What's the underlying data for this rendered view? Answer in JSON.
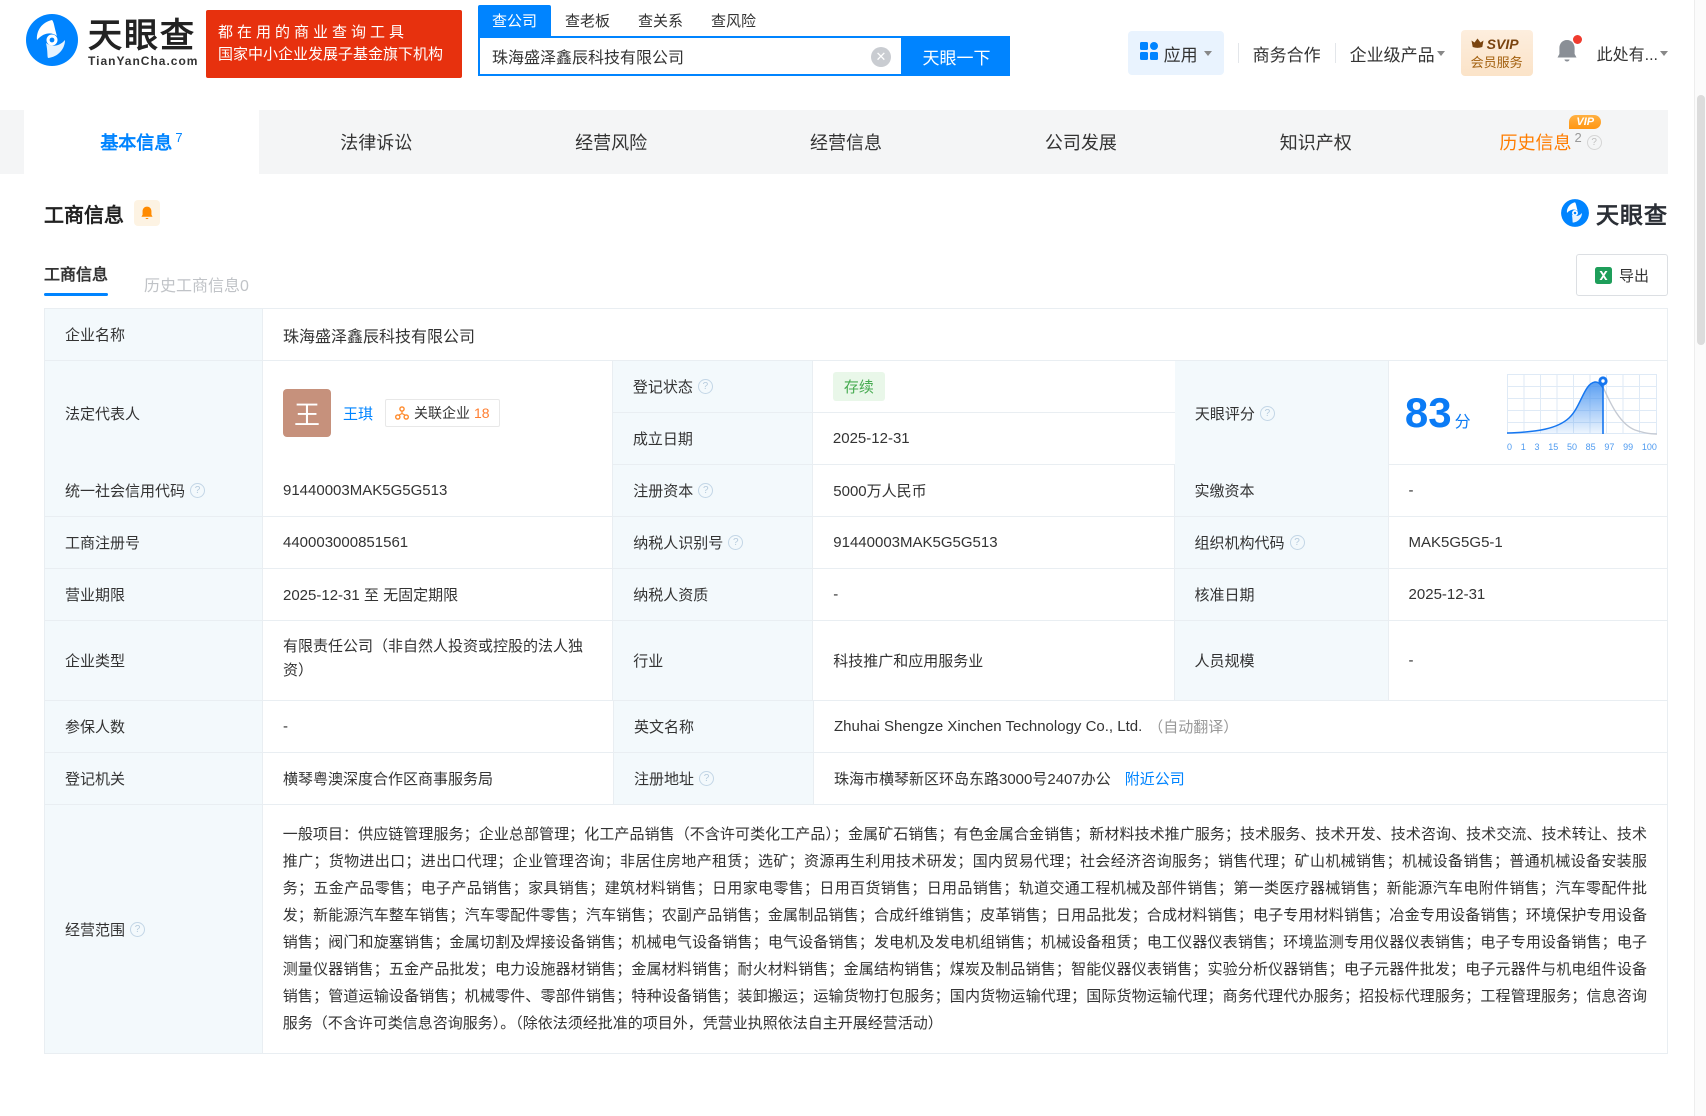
{
  "header": {
    "brand": {
      "title": "天眼查",
      "domain": "TianYanCha.com"
    },
    "promo": {
      "line1": "都在用的商业查询工具",
      "line2": "国家中小企业发展子基金旗下机构"
    },
    "search": {
      "tabs": [
        {
          "label": "查公司"
        },
        {
          "label": "查老板"
        },
        {
          "label": "查关系"
        },
        {
          "label": "查风险"
        }
      ],
      "value": "珠海盛泽鑫辰科技有限公司",
      "button": "天眼一下"
    },
    "menu": {
      "apps": "应用",
      "cooperation": "商务合作",
      "enterprise": "企业级产品",
      "svip_top": "SVIP",
      "svip_bottom": "会员服务",
      "user": "此处有..."
    }
  },
  "nav": {
    "tabs": [
      {
        "label": "基本信息",
        "badge": "7"
      },
      {
        "label": "法律诉讼",
        "badge": ""
      },
      {
        "label": "经营风险",
        "badge": ""
      },
      {
        "label": "经营信息",
        "badge": ""
      },
      {
        "label": "公司发展",
        "badge": ""
      },
      {
        "label": "知识产权",
        "badge": ""
      },
      {
        "label": "历史信息",
        "badge": "2",
        "vip": "VIP"
      }
    ]
  },
  "section": {
    "title": "工商信息",
    "watermark": "天眼查",
    "subtab_active": "工商信息",
    "subtab_history": "历史工商信息0",
    "export_label": "导出"
  },
  "table": {
    "company_name": {
      "label": "企业名称",
      "value": "珠海盛泽鑫辰科技有限公司"
    },
    "legal_rep": {
      "label": "法定代表人",
      "avatar": "王",
      "name": "王琪",
      "related_label": "关联企业",
      "related_count": "18"
    },
    "reg_status": {
      "label": "登记状态",
      "value": "存续"
    },
    "establish_date": {
      "label": "成立日期",
      "value": "2025-12-31"
    },
    "score": {
      "label": "天眼评分",
      "value": "83",
      "unit": "分",
      "ticks": [
        "0",
        "1",
        "3",
        "15",
        "50",
        "85",
        "97",
        "99",
        "100"
      ]
    },
    "credit_code": {
      "label": "统一社会信用代码",
      "value": "91440003MAK5G5G513"
    },
    "reg_capital": {
      "label": "注册资本",
      "value": "5000万人民币"
    },
    "paid_capital": {
      "label": "实缴资本",
      "value": "-"
    },
    "reg_number": {
      "label": "工商注册号",
      "value": "440003000851561"
    },
    "taxpayer_id": {
      "label": "纳税人识别号",
      "value": "91440003MAK5G5G513"
    },
    "org_code": {
      "label": "组织机构代码",
      "value": "MAK5G5G5-1"
    },
    "business_term": {
      "label": "营业期限",
      "value": "2025-12-31 至 无固定期限"
    },
    "taxpayer_qualification": {
      "label": "纳税人资质",
      "value": "-"
    },
    "approval_date": {
      "label": "核准日期",
      "value": "2025-12-31"
    },
    "company_type": {
      "label": "企业类型",
      "value": "有限责任公司（非自然人投资或控股的法人独资）"
    },
    "industry": {
      "label": "行业",
      "value": "科技推广和应用服务业"
    },
    "staff_size": {
      "label": "人员规模",
      "value": "-"
    },
    "insured_count": {
      "label": "参保人数",
      "value": "-"
    },
    "english_name": {
      "label": "英文名称",
      "value": "Zhuhai Shengze Xinchen Technology Co., Ltd.",
      "note": "（自动翻译）"
    },
    "reg_authority": {
      "label": "登记机关",
      "value": "横琴粤澳深度合作区商事服务局"
    },
    "reg_address": {
      "label": "注册地址",
      "value": "珠海市横琴新区环岛东路3000号2407办公",
      "link": "附近公司"
    },
    "business_scope": {
      "label": "经营范围",
      "value": "一般项目：供应链管理服务；企业总部管理；化工产品销售（不含许可类化工产品）；金属矿石销售；有色金属合金销售；新材料技术推广服务；技术服务、技术开发、技术咨询、技术交流、技术转让、技术推广；货物进出口；进出口代理；企业管理咨询；非居住房地产租赁；选矿；资源再生利用技术研发；国内贸易代理；社会经济咨询服务；销售代理；矿山机械销售；机械设备销售；普通机械设备安装服务；五金产品零售；电子产品销售；家具销售；建筑材料销售；日用家电零售；日用百货销售；日用品销售；轨道交通工程机械及部件销售；第一类医疗器械销售；新能源汽车电附件销售；汽车零配件批发；新能源汽车整车销售；汽车零配件零售；汽车销售；农副产品销售；金属制品销售；合成纤维销售；皮革销售；日用品批发；合成材料销售；电子专用材料销售；冶金专用设备销售；环境保护专用设备销售；阀门和旋塞销售；金属切割及焊接设备销售；机械电气设备销售；电气设备销售；发电机及发电机组销售；机械设备租赁；电工仪器仪表销售；环境监测专用仪器仪表销售；电子专用设备销售；电子测量仪器销售；五金产品批发；电力设施器材销售；金属材料销售；耐火材料销售；金属结构销售；煤炭及制品销售；智能仪器仪表销售；实验分析仪器销售；电子元器件批发；电子元器件与机电组件设备销售；管道运输设备销售；机械零件、零部件销售；特种设备销售；装卸搬运；运输货物打包服务；国内货物运输代理；国际货物运输代理；商务代理代办服务；招投标代理服务；工程管理服务；信息咨询服务（不含许可类信息咨询服务）。（除依法须经批准的项目外，凭营业执照依法自主开展经营活动）"
    }
  }
}
